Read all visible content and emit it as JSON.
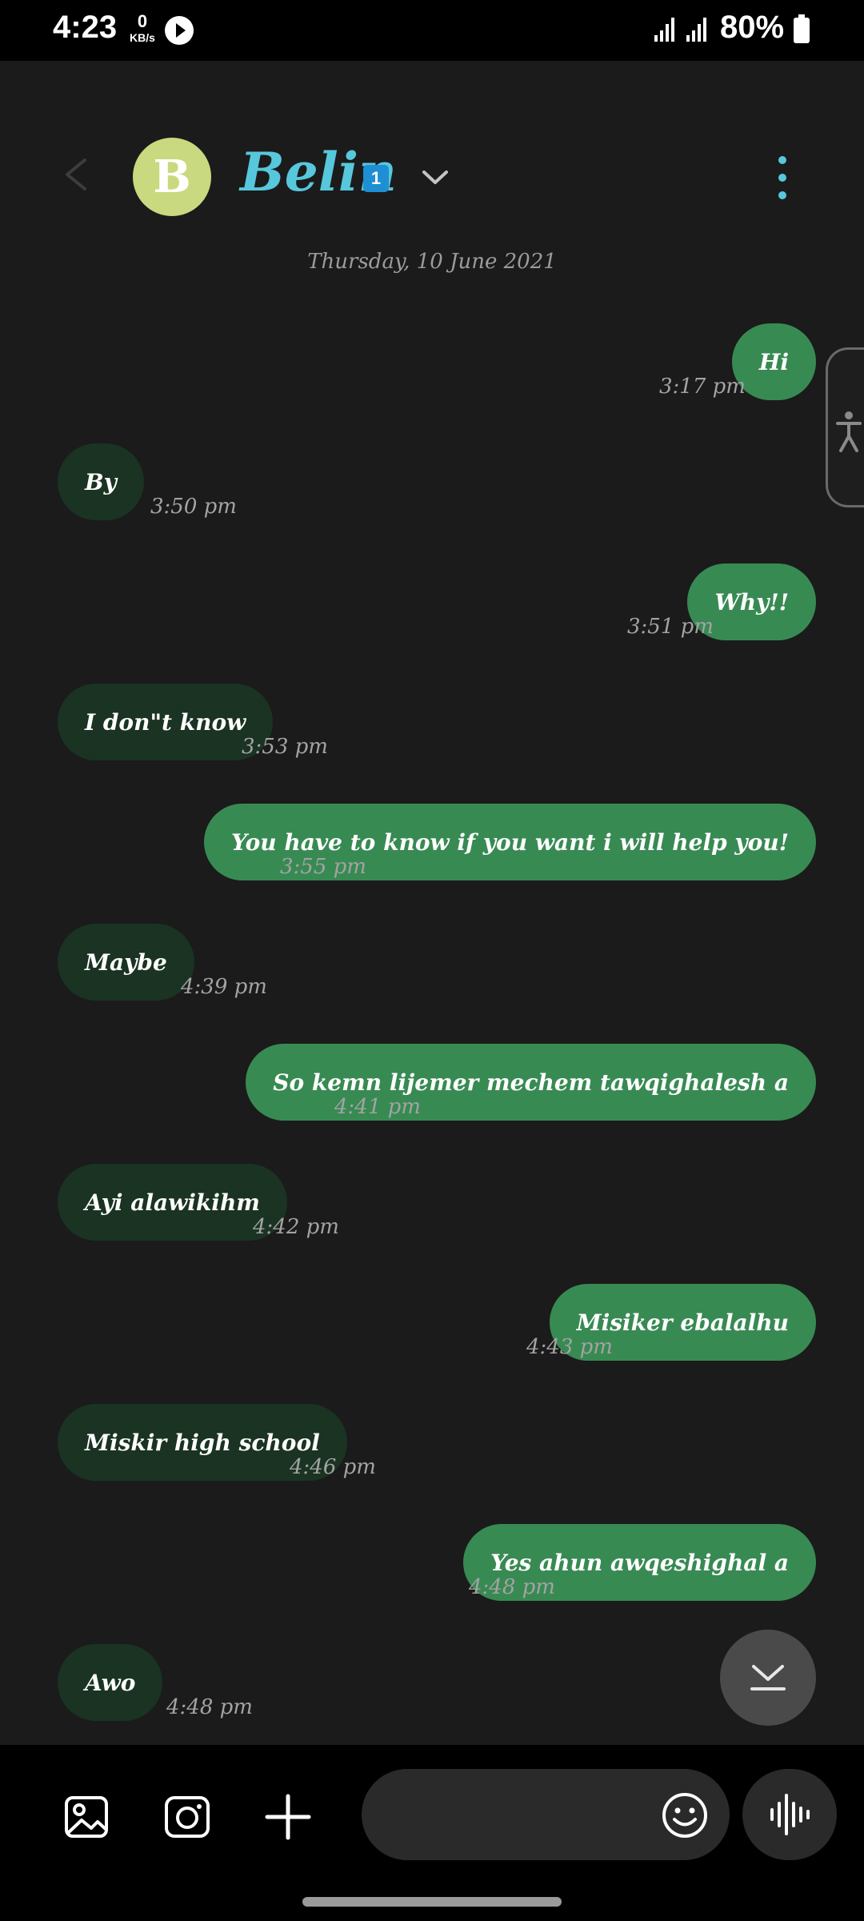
{
  "status_bar": {
    "time": "4:23",
    "net_speed_value": "0",
    "net_speed_unit": "KB/s",
    "battery": "80%"
  },
  "header": {
    "avatar_letter": "B",
    "contact_name": "Belin",
    "sim_badge": "1"
  },
  "conversation": {
    "date": "Thursday, 10 June 2021",
    "messages": [
      {
        "direction": "out",
        "text": "Hi",
        "time": "3:17 pm"
      },
      {
        "direction": "in",
        "text": "By",
        "time": "3:50 pm"
      },
      {
        "direction": "out",
        "text": "Why!!",
        "time": "3:51 pm"
      },
      {
        "direction": "in",
        "text": "I don\"t know",
        "time": "3:53 pm"
      },
      {
        "direction": "out",
        "text": "You have to know if you want i will help you!",
        "time": "3:55 pm"
      },
      {
        "direction": "in",
        "text": "Maybe",
        "time": "4:39 pm"
      },
      {
        "direction": "out",
        "text": "So kemn lijemer mechem tawqighalesh a",
        "time": "4:41 pm"
      },
      {
        "direction": "in",
        "text": "Ayi alawikihm",
        "time": "4:42 pm"
      },
      {
        "direction": "out",
        "text": "Misiker ebalalhu",
        "time": "4:43 pm"
      },
      {
        "direction": "in",
        "text": "Miskir high school",
        "time": "4:46 pm"
      },
      {
        "direction": "out",
        "text": "Yes ahun awqeshighal a",
        "time": "4:48 pm"
      },
      {
        "direction": "in",
        "text": "Awo",
        "time": "4:48 pm"
      }
    ]
  },
  "composer": {
    "placeholder": ""
  },
  "colors": {
    "outgoing_bubble": "#388a53",
    "incoming_bubble": "#1a3322",
    "contact_name": "#57c7dc",
    "avatar": "#c9d97f",
    "background": "#1b1b1b"
  }
}
